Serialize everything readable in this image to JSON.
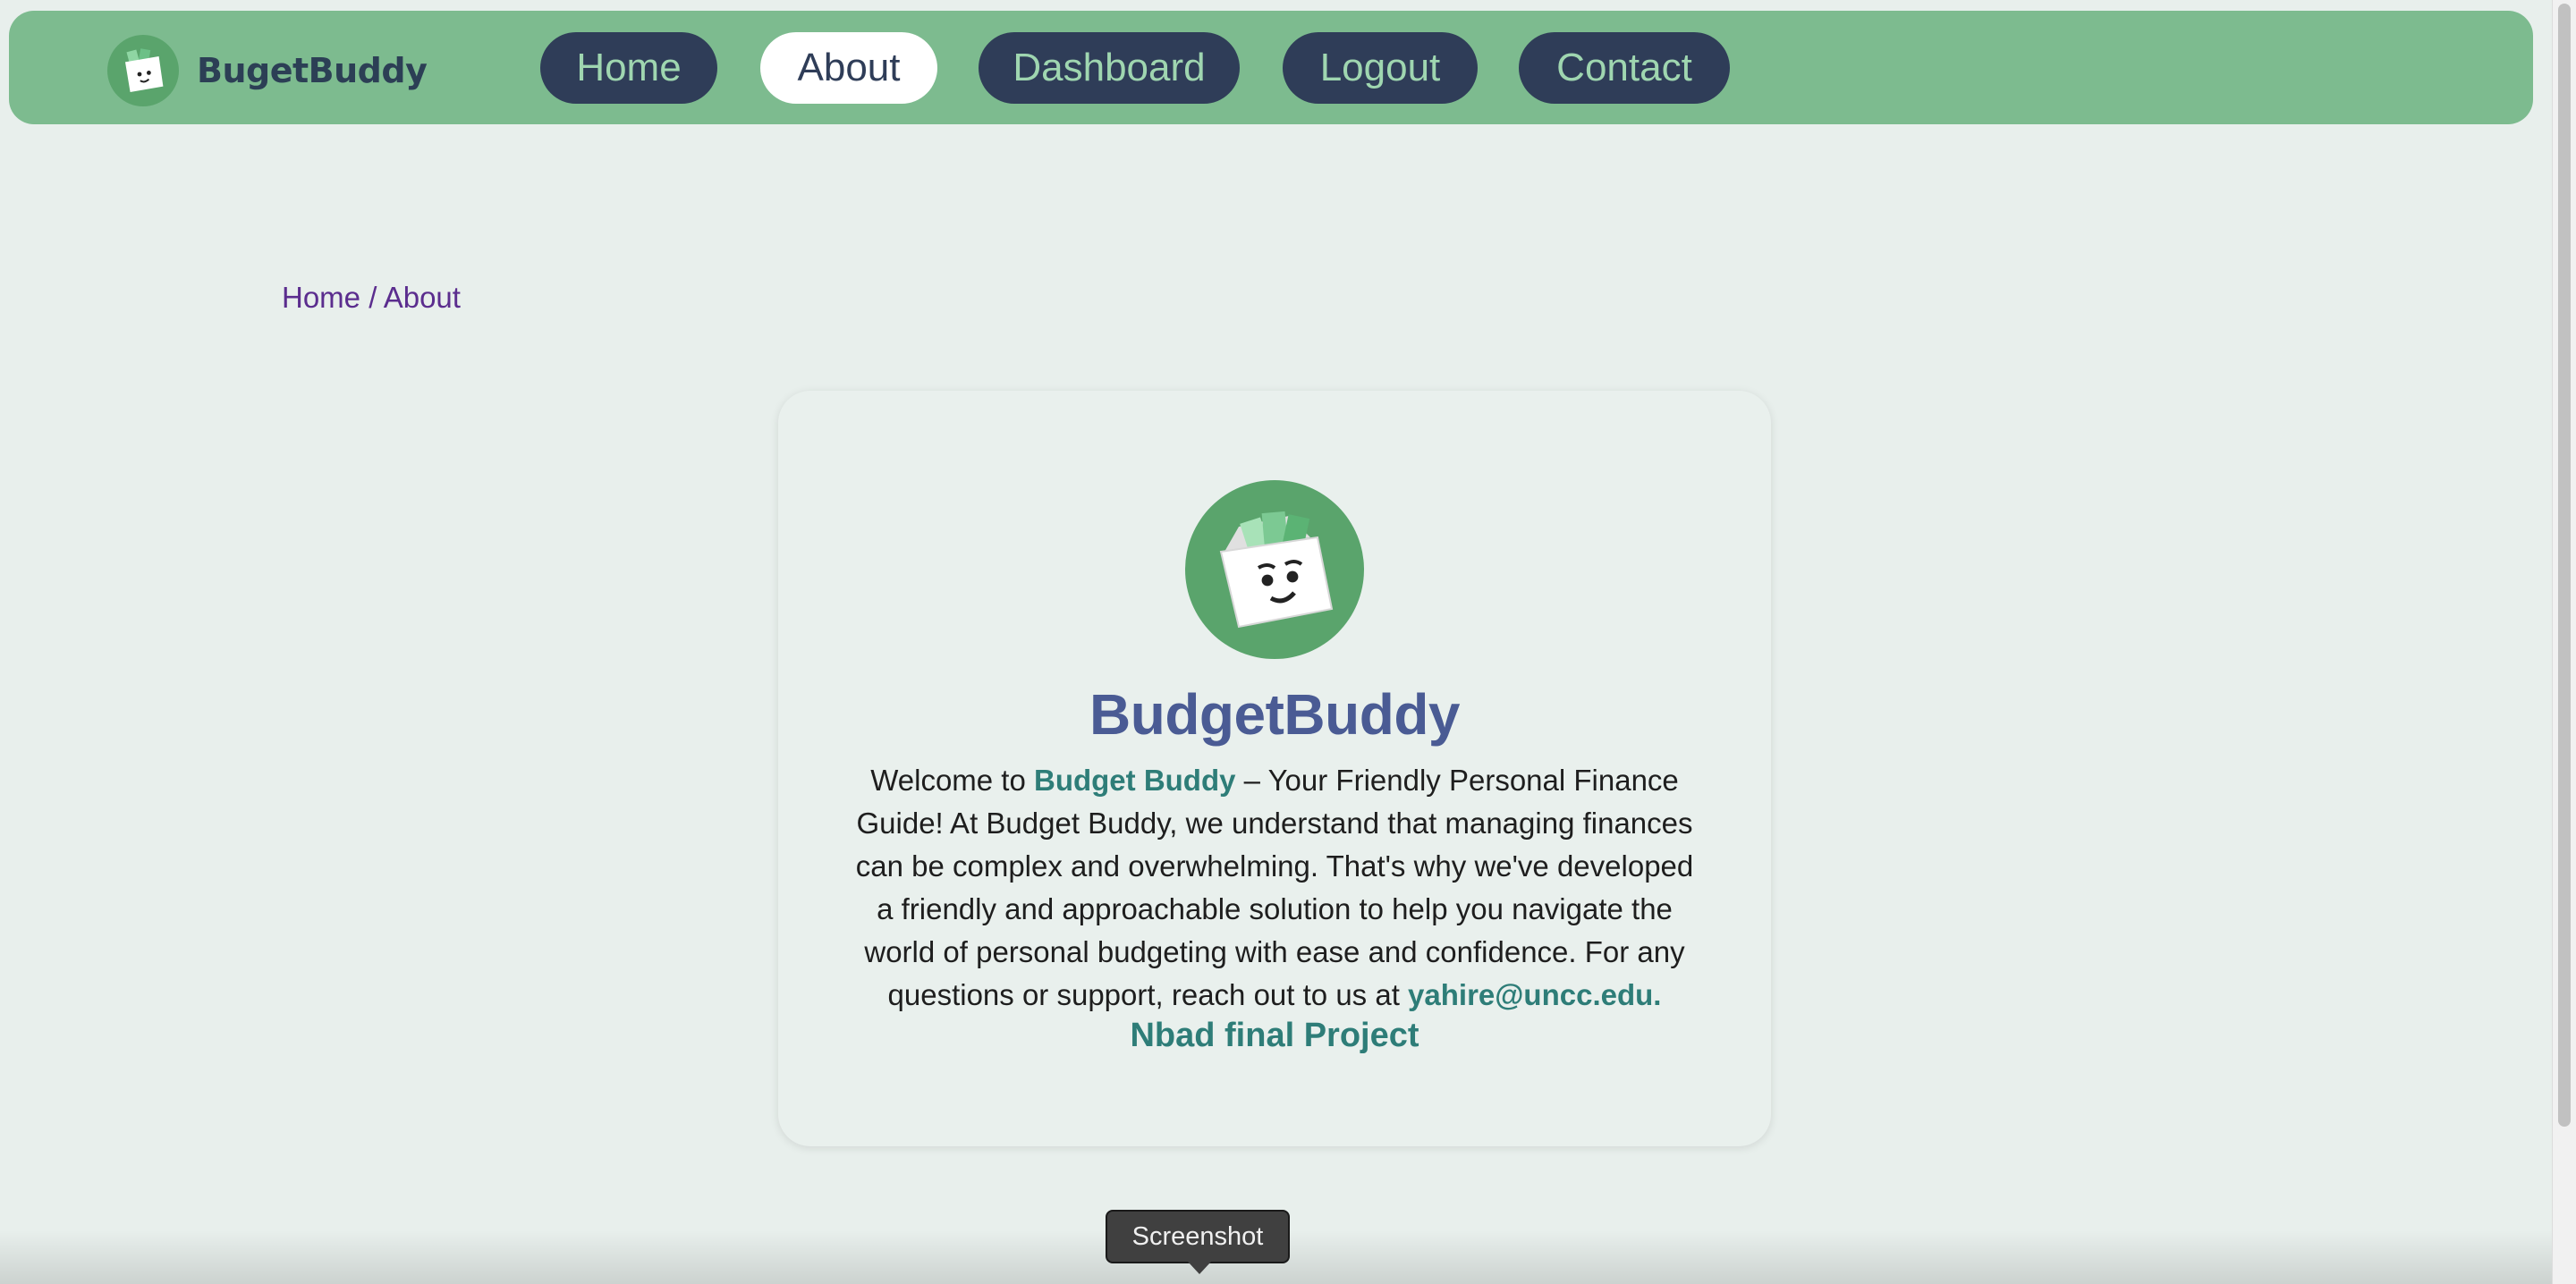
{
  "brand": {
    "name": "BugetBuddy",
    "logo_icon": "wallet-mascot-icon"
  },
  "nav": {
    "items": [
      {
        "label": "Home",
        "active": false
      },
      {
        "label": "About",
        "active": true
      },
      {
        "label": "Dashboard",
        "active": false
      },
      {
        "label": "Logout",
        "active": false
      },
      {
        "label": "Contact",
        "active": false
      }
    ]
  },
  "breadcrumb": {
    "home": "Home",
    "separator": " / ",
    "current": "About"
  },
  "card": {
    "title": "BudgetBuddy",
    "body_prefix": "Welcome to ",
    "body_highlight": "Budget Buddy",
    "body_main": " – Your Friendly Personal Finance Guide! At Budget Buddy, we understand that managing finances can be complex and overwhelming. That's why we've developed a friendly and approachable solution to help you navigate the world of personal budgeting with ease and confidence. For any questions or support, reach out to us at ",
    "email": "yahire@uncc.edu.",
    "footer": "Nbad final Project"
  },
  "tooltip": {
    "label": "Screenshot"
  },
  "colors": {
    "navbar_bg": "#7dbb8f",
    "nav_button_bg": "#2f3d58",
    "nav_button_text": "#9fd6b0",
    "page_bg": "#e8efec",
    "title": "#4a5b94",
    "accent": "#2e7d78",
    "breadcrumb": "#5b2d8e"
  }
}
